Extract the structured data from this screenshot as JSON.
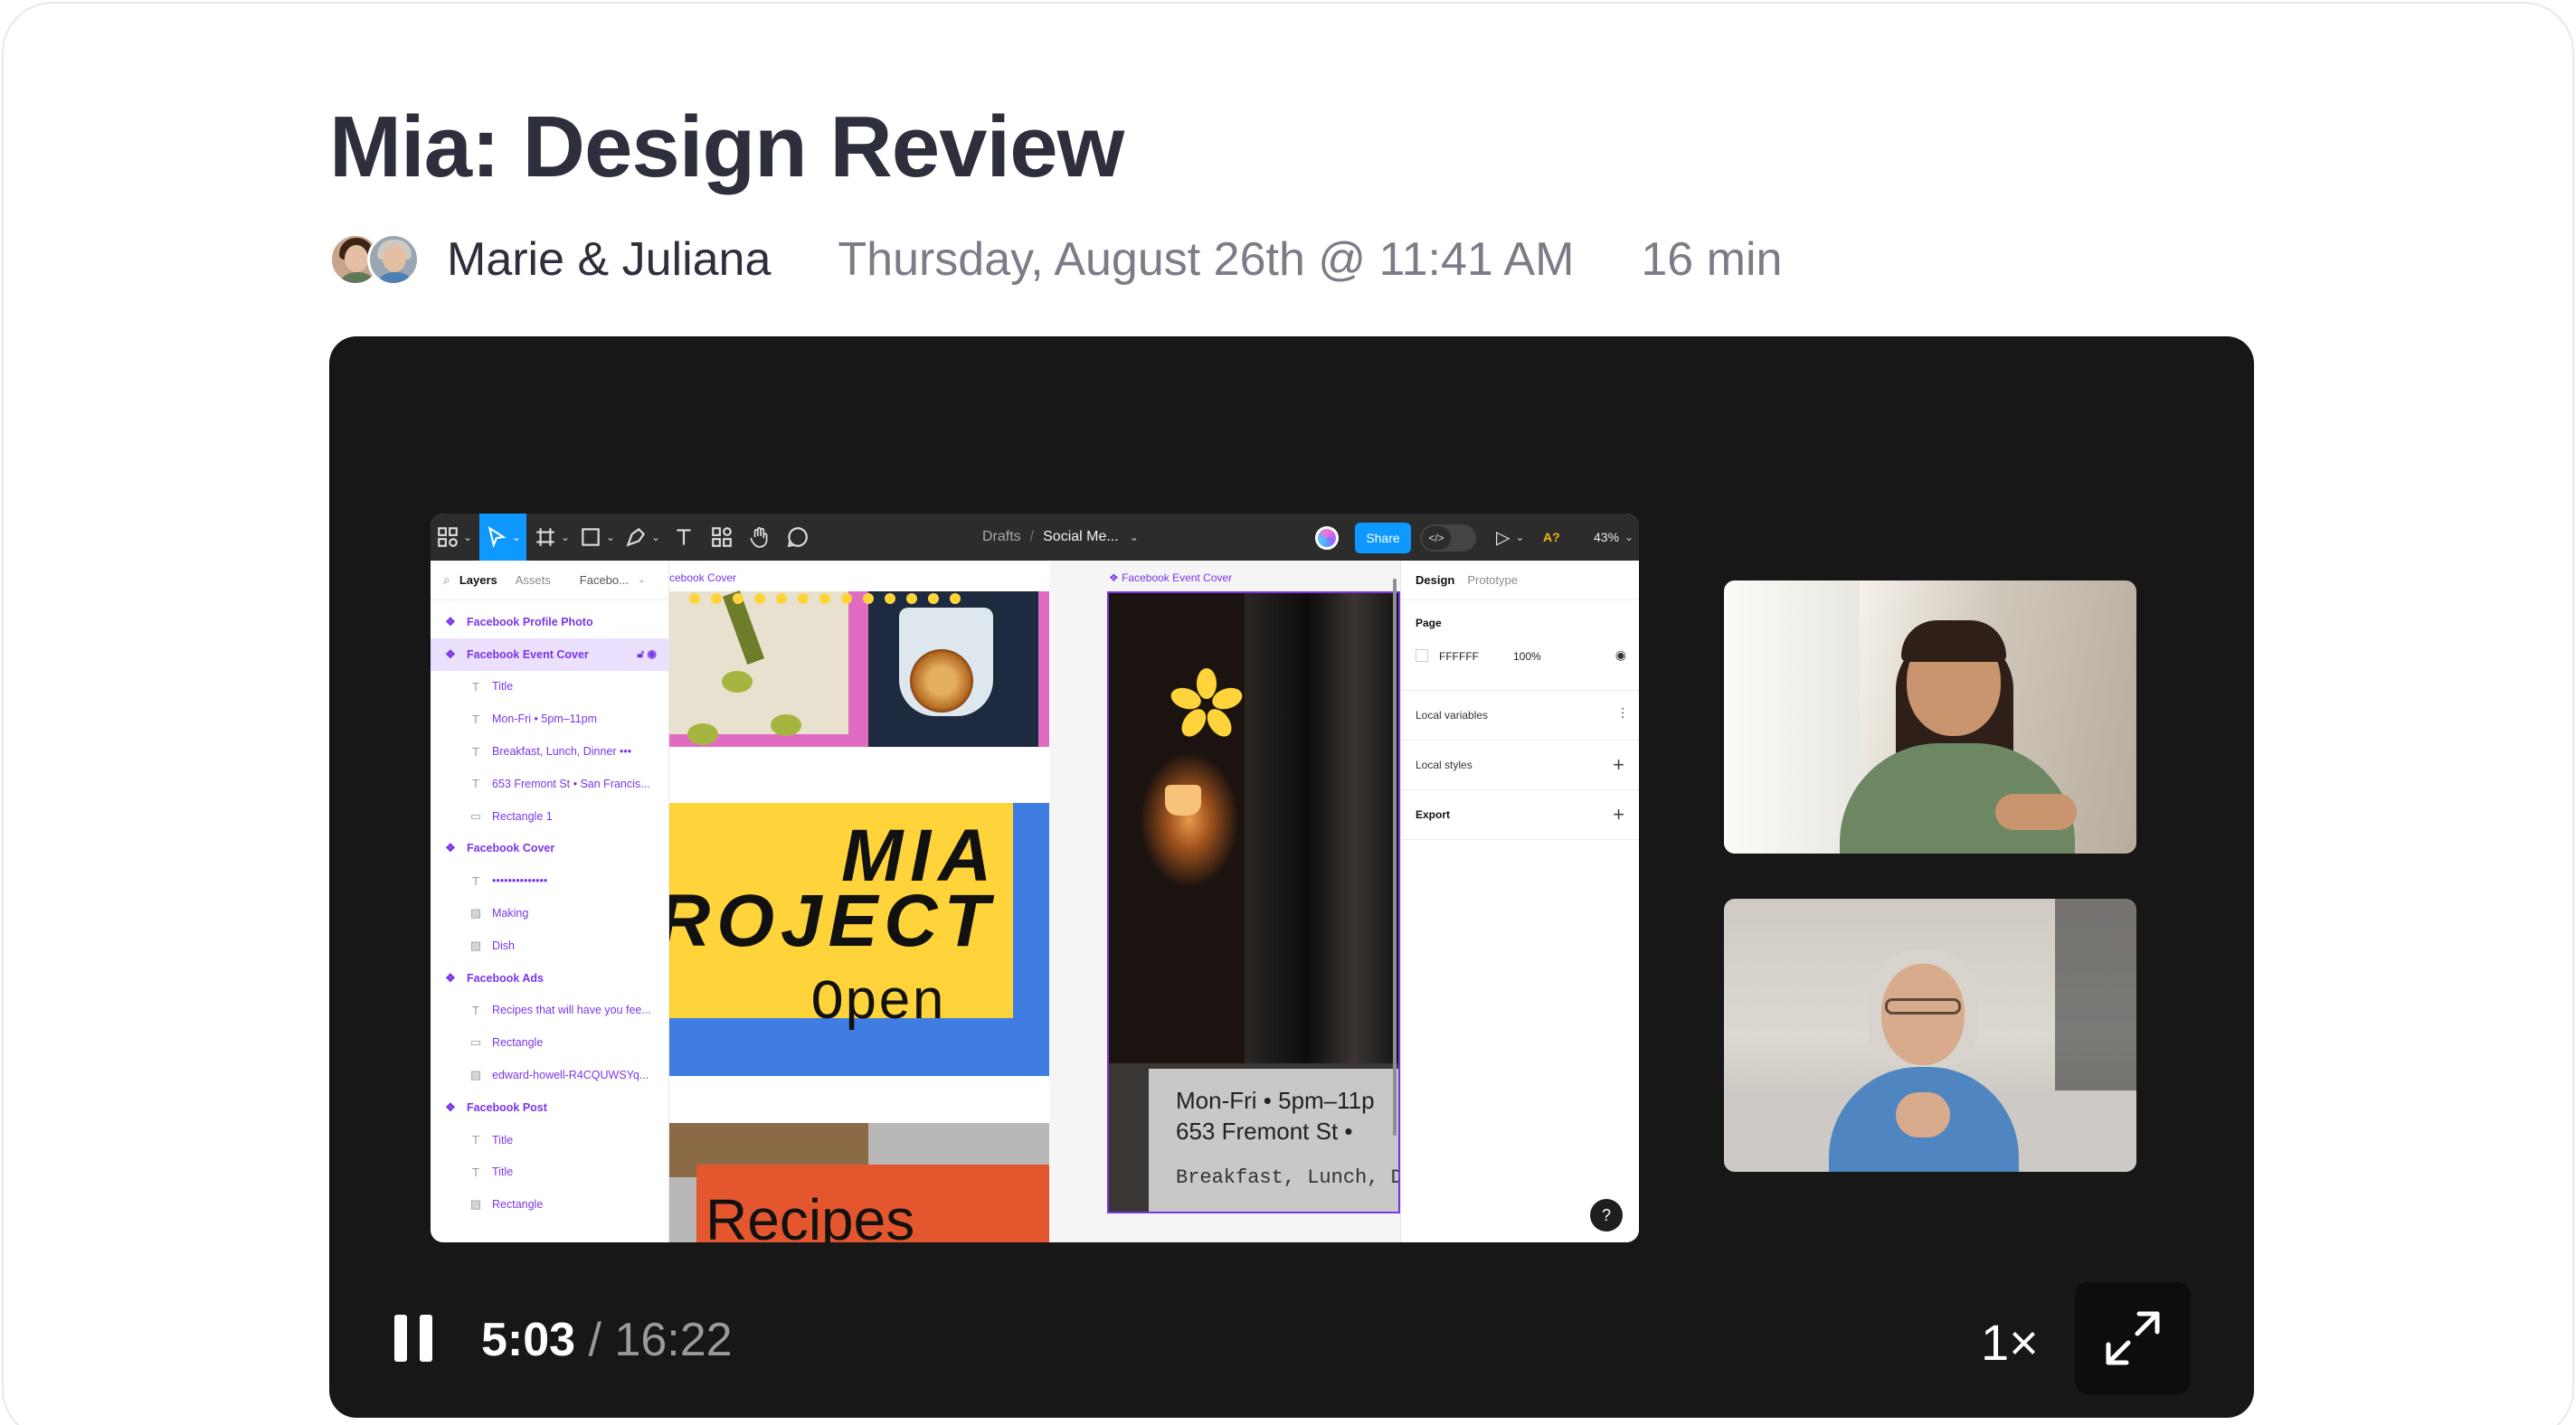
{
  "page": {
    "title": "Mia: Design Review",
    "participants": "Marie & Juliana",
    "date": "Thursday, August 26th @ 11:41 AM",
    "duration": "16 min"
  },
  "figma": {
    "breadcrumb_root": "Drafts",
    "breadcrumb_sep": "/",
    "file_name": "Social Me...",
    "share_label": "Share",
    "zoom": "43%",
    "aa_label": "A?",
    "layer_tabs": {
      "layers": "Layers",
      "assets": "Assets",
      "page": "Facebo..."
    },
    "layers": [
      {
        "label": "Facebook Profile Photo",
        "kind": "frame"
      },
      {
        "label": "Facebook Event Cover",
        "kind": "frame",
        "selected": true
      },
      {
        "label": "Title",
        "kind": "text"
      },
      {
        "label": "Mon-Fri • 5pm–11pm",
        "kind": "text"
      },
      {
        "label": "Breakfast, Lunch, Dinner •••",
        "kind": "text"
      },
      {
        "label": "653 Fremont St • San Francis...",
        "kind": "text"
      },
      {
        "label": "Rectangle 1",
        "kind": "rect"
      },
      {
        "label": "Facebook Cover",
        "kind": "frame"
      },
      {
        "label": "••••••••••••••",
        "kind": "text"
      },
      {
        "label": "Making",
        "kind": "image"
      },
      {
        "label": "Dish",
        "kind": "image"
      },
      {
        "label": "Facebook Ads",
        "kind": "frame"
      },
      {
        "label": "Recipes that will have you fee...",
        "kind": "text"
      },
      {
        "label": "Rectangle",
        "kind": "rect"
      },
      {
        "label": "edward-howell-R4CQUWSYq...",
        "kind": "image"
      },
      {
        "label": "Facebook Post",
        "kind": "frame"
      },
      {
        "label": "Title",
        "kind": "text"
      },
      {
        "label": "Title",
        "kind": "text"
      },
      {
        "label": "Rectangle",
        "kind": "image"
      }
    ],
    "canvas": {
      "label_cover": "cebook Cover",
      "label_event": "Facebook Event Cover",
      "mia_line1": "MIA",
      "mia_line2": "ROJECT",
      "mia_line3": "Open",
      "recipes": "Recipes",
      "event_line1": "Mon-Fri   •   5pm–11p",
      "event_line2": "653 Fremont St   •",
      "event_line3": "Breakfast, Lunch, D"
    },
    "props": {
      "tab_design": "Design",
      "tab_prototype": "Prototype",
      "page_title": "Page",
      "page_color": "FFFFFF",
      "page_opacity": "100%",
      "local_variables": "Local variables",
      "local_styles": "Local styles",
      "export": "Export"
    },
    "help": "?"
  },
  "player": {
    "current_time": "5:03",
    "separator": " / ",
    "total_time": "16:22",
    "speed": "1×"
  },
  "icons": {
    "play": "play-icon",
    "pause": "pause-icon",
    "fullscreen": "expand-icon",
    "eye": "eye-icon"
  },
  "colors": {
    "accent_figma": "#0d99ff",
    "layer_purple": "#7b35e9",
    "player_bg": "#171717",
    "title_text": "#2e2f3d"
  }
}
